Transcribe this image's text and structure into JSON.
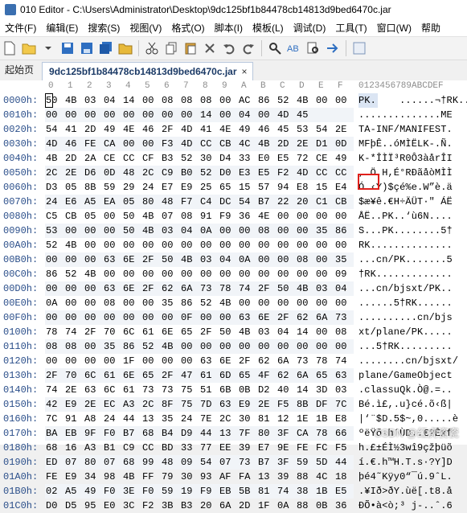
{
  "window": {
    "title": "010 Editor - C:\\Users\\Administrator\\Desktop\\9dc125bf1b84478cb14813d9bed6470c.jar"
  },
  "menu": [
    "文件(F)",
    "编辑(E)",
    "搜索(S)",
    "视图(V)",
    "格式(O)",
    "脚本(I)",
    "模板(L)",
    "调试(D)",
    "工具(T)",
    "窗口(W)",
    "帮助"
  ],
  "tabs": {
    "start": "起始页",
    "file": "9dc125bf1b84478cb14813d9bed6470c.jar",
    "close": "×"
  },
  "header": {
    "cols": [
      "0",
      "1",
      "2",
      "3",
      "4",
      "5",
      "6",
      "7",
      "8",
      "9",
      "A",
      "B",
      "C",
      "D",
      "E",
      "F"
    ],
    "ascii": "0123456789ABCDEF"
  },
  "rows": [
    {
      "addr": "0000h:",
      "hex": [
        "50",
        "4B",
        "03",
        "04",
        "14",
        "00",
        "08",
        "08",
        "08",
        "00",
        "AC",
        "86",
        "52",
        "4B",
        "00",
        "00"
      ],
      "ascii": "PK.    ......¬†RK.."
    },
    {
      "addr": "0010h:",
      "hex": [
        "00",
        "00",
        "00",
        "00",
        "00",
        "00",
        "00",
        "00",
        "14",
        "00",
        "04",
        "00",
        "4D",
        "45"
      ],
      "ascii": "..............ME"
    },
    {
      "addr": "0020h:",
      "hex": [
        "54",
        "41",
        "2D",
        "49",
        "4E",
        "46",
        "2F",
        "4D",
        "41",
        "4E",
        "49",
        "46",
        "45",
        "53",
        "54",
        "2E"
      ],
      "ascii": "TA-INF/MANIFEST."
    },
    {
      "addr": "0030h:",
      "hex": [
        "4D",
        "46",
        "FE",
        "CA",
        "00",
        "00",
        "F3",
        "4D",
        "CC",
        "CB",
        "4C",
        "4B",
        "2D",
        "2E",
        "D1",
        "0D"
      ],
      "ascii": "MFþÊ..óMÌËLK-.Ñ."
    },
    {
      "addr": "0040h:",
      "hex": [
        "4B",
        "2D",
        "2A",
        "CE",
        "CC",
        "CF",
        "B3",
        "52",
        "30",
        "D4",
        "33",
        "E0",
        "E5",
        "72",
        "CE",
        "49"
      ],
      "ascii": "K-*ÎÌÏ³R0Ô3àårÎI"
    },
    {
      "addr": "0050h:",
      "hex": [
        "2C",
        "2E",
        "D6",
        "0D",
        "48",
        "2C",
        "C9",
        "B0",
        "52",
        "D0",
        "E3",
        "E5",
        "F2",
        "4D",
        "CC",
        "CC"
      ],
      "ascii": ",.Ö.H,É°RÐãåòMÌÌ"
    },
    {
      "addr": "0060h:",
      "hex": [
        "D3",
        "05",
        "8B",
        "59",
        "29",
        "24",
        "E7",
        "E9",
        "25",
        "65",
        "15",
        "57",
        "94",
        "E8",
        "15",
        "E4"
      ],
      "ascii": "Ó.‹Y)$çé%e.W”è.ä"
    },
    {
      "addr": "0070h:",
      "hex": [
        "24",
        "E6",
        "A5",
        "EA",
        "05",
        "80",
        "48",
        "F7",
        "C4",
        "DC",
        "54",
        "B7",
        "22",
        "20",
        "C1",
        "CB"
      ],
      "ascii": "$æ¥ê.€H÷ÄÜT·\" ÁË"
    },
    {
      "addr": "0080h:",
      "hex": [
        "C5",
        "CB",
        "05",
        "00",
        "50",
        "4B",
        "07",
        "08",
        "91",
        "F9",
        "36",
        "4E",
        "00",
        "00",
        "00",
        "00"
      ],
      "ascii": "ÅË..PK..‘ù6N...."
    },
    {
      "addr": "0090h:",
      "hex": [
        "53",
        "00",
        "00",
        "00",
        "50",
        "4B",
        "03",
        "04",
        "0A",
        "00",
        "00",
        "08",
        "00",
        "00",
        "35",
        "86"
      ],
      "ascii": "S...PK........5†"
    },
    {
      "addr": "00A0h:",
      "hex": [
        "52",
        "4B",
        "00",
        "00",
        "00",
        "00",
        "00",
        "00",
        "00",
        "00",
        "00",
        "00",
        "00",
        "00",
        "00",
        "00"
      ],
      "ascii": "RK.............."
    },
    {
      "addr": "00B0h:",
      "hex": [
        "00",
        "00",
        "00",
        "63",
        "6E",
        "2F",
        "50",
        "4B",
        "03",
        "04",
        "0A",
        "00",
        "00",
        "08",
        "00",
        "35"
      ],
      "ascii": "...cn/PK.......5"
    },
    {
      "addr": "00C0h:",
      "hex": [
        "86",
        "52",
        "4B",
        "00",
        "00",
        "00",
        "00",
        "00",
        "00",
        "00",
        "00",
        "00",
        "00",
        "00",
        "00",
        "09"
      ],
      "ascii": "†RK............."
    },
    {
      "addr": "00D0h:",
      "hex": [
        "00",
        "00",
        "00",
        "63",
        "6E",
        "2F",
        "62",
        "6A",
        "73",
        "78",
        "74",
        "2F",
        "50",
        "4B",
        "03",
        "04"
      ],
      "ascii": "...cn/bjsxt/PK.."
    },
    {
      "addr": "00E0h:",
      "hex": [
        "0A",
        "00",
        "00",
        "08",
        "00",
        "00",
        "35",
        "86",
        "52",
        "4B",
        "00",
        "00",
        "00",
        "00",
        "00",
        "00"
      ],
      "ascii": "......5†RK......"
    },
    {
      "addr": "00F0h:",
      "hex": [
        "00",
        "00",
        "00",
        "00",
        "00",
        "00",
        "00",
        "0F",
        "00",
        "00",
        "63",
        "6E",
        "2F",
        "62",
        "6A",
        "73"
      ],
      "ascii": "..........cn/bjs"
    },
    {
      "addr": "0100h:",
      "hex": [
        "78",
        "74",
        "2F",
        "70",
        "6C",
        "61",
        "6E",
        "65",
        "2F",
        "50",
        "4B",
        "03",
        "04",
        "14",
        "00",
        "08"
      ],
      "ascii": "xt/plane/PK....."
    },
    {
      "addr": "0110h:",
      "hex": [
        "08",
        "08",
        "00",
        "35",
        "86",
        "52",
        "4B",
        "00",
        "00",
        "00",
        "00",
        "00",
        "00",
        "00",
        "00",
        "00"
      ],
      "ascii": "...5†RK........."
    },
    {
      "addr": "0120h:",
      "hex": [
        "00",
        "00",
        "00",
        "00",
        "1F",
        "00",
        "00",
        "00",
        "63",
        "6E",
        "2F",
        "62",
        "6A",
        "73",
        "78",
        "74"
      ],
      "ascii": "........cn/bjsxt/"
    },
    {
      "addr": "0130h:",
      "hex": [
        "2F",
        "70",
        "6C",
        "61",
        "6E",
        "65",
        "2F",
        "47",
        "61",
        "6D",
        "65",
        "4F",
        "62",
        "6A",
        "65",
        "63"
      ],
      "ascii": "plane/GameObject"
    },
    {
      "addr": "0140h:",
      "hex": [
        "74",
        "2E",
        "63",
        "6C",
        "61",
        "73",
        "73",
        "75",
        "51",
        "6B",
        "0B",
        "D2",
        "40",
        "14",
        "3D",
        "03"
      ],
      "ascii": ".classuQk.Ò@.=.."
    },
    {
      "addr": "0150h:",
      "hex": [
        "42",
        "E9",
        "2E",
        "EC",
        "A3",
        "2C",
        "8F",
        "75",
        "7D",
        "63",
        "E9",
        "2E",
        "F5",
        "8B",
        "DF",
        "7C"
      ],
      "ascii": "Bé.ì£,.u}cé.õ‹ß|"
    },
    {
      "addr": "0160h:",
      "hex": [
        "7C",
        "91",
        "A8",
        "24",
        "44",
        "13",
        "35",
        "24",
        "7E",
        "2C",
        "30",
        "81",
        "12",
        "1E",
        "1B",
        "E8"
      ],
      "ascii": "|‘¨$D.5$~,0.....è"
    },
    {
      "addr": "0170h:",
      "hex": [
        "BA",
        "EB",
        "9F",
        "F0",
        "B7",
        "68",
        "B4",
        "D9",
        "44",
        "13",
        "7F",
        "80",
        "3F",
        "CA",
        "78",
        "66"
      ],
      "ascii": "ºëŸð·h´ÙD..€?Êxf"
    },
    {
      "addr": "0180h:",
      "hex": [
        "68",
        "16",
        "A3",
        "B1",
        "C9",
        "CC",
        "BD",
        "33",
        "77",
        "EE",
        "39",
        "E7",
        "9E",
        "FE",
        "FC",
        "F5"
      ],
      "ascii": "h.£±ÉÌ½3wî9çžþüõ"
    },
    {
      "addr": "0190h:",
      "hex": [
        "ED",
        "07",
        "80",
        "07",
        "68",
        "99",
        "48",
        "09",
        "54",
        "07",
        "73",
        "B7",
        "3F",
        "59",
        "5D",
        "44"
      ],
      "ascii": "í.€.h™H.T.s·?Y]D"
    },
    {
      "addr": "01A0h:",
      "hex": [
        "FE",
        "E9",
        "34",
        "98",
        "4B",
        "FF",
        "79",
        "30",
        "93",
        "AF",
        "FA",
        "13",
        "39",
        "88",
        "4C",
        "18"
      ],
      "ascii": "þé4˜Kÿy0“¯ú.9ˆL."
    },
    {
      "addr": "01B0h:",
      "hex": [
        "02",
        "A5",
        "49",
        "F0",
        "3E",
        "F0",
        "59",
        "19",
        "F9",
        "EB",
        "5B",
        "81",
        "74",
        "38",
        "1B",
        "E5"
      ],
      "ascii": ".¥Ið>ðY.ùë[.t8.å"
    },
    {
      "addr": "01C0h:",
      "hex": [
        "D0",
        "D5",
        "95",
        "E0",
        "3C",
        "F2",
        "3B",
        "B3",
        "20",
        "6A",
        "2D",
        "1F",
        "0A",
        "88",
        "0B",
        "36"
      ],
      "ascii": "ÐÕ•à<ò;³ j-..ˆ.6"
    }
  ],
  "watermark": "CSDN @红虎瓷瓷"
}
